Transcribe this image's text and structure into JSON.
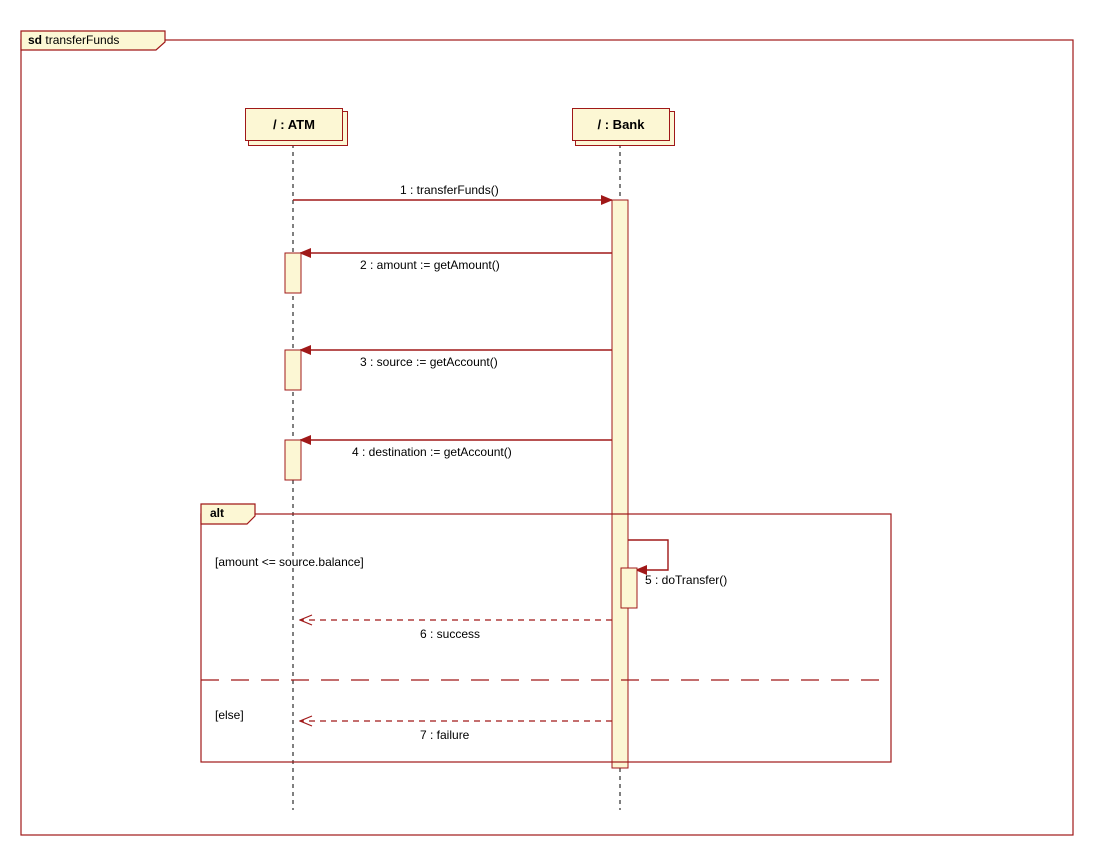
{
  "frame": {
    "keyword": "sd",
    "name": "transferFunds"
  },
  "lifelines": {
    "atm": {
      "label": "/ : ATM"
    },
    "bank": {
      "label": "/ : Bank"
    }
  },
  "messages": {
    "m1": "1 : transferFunds()",
    "m2": "2 : amount := getAmount()",
    "m3": "3 : source := getAccount()",
    "m4": "4 : destination := getAccount()",
    "m5": "5 : doTransfer()",
    "m6": "6 : success",
    "m7": "7 : failure"
  },
  "alt": {
    "keyword": "alt",
    "guard1": "[amount <= source.balance]",
    "guard2": "[else]"
  }
}
